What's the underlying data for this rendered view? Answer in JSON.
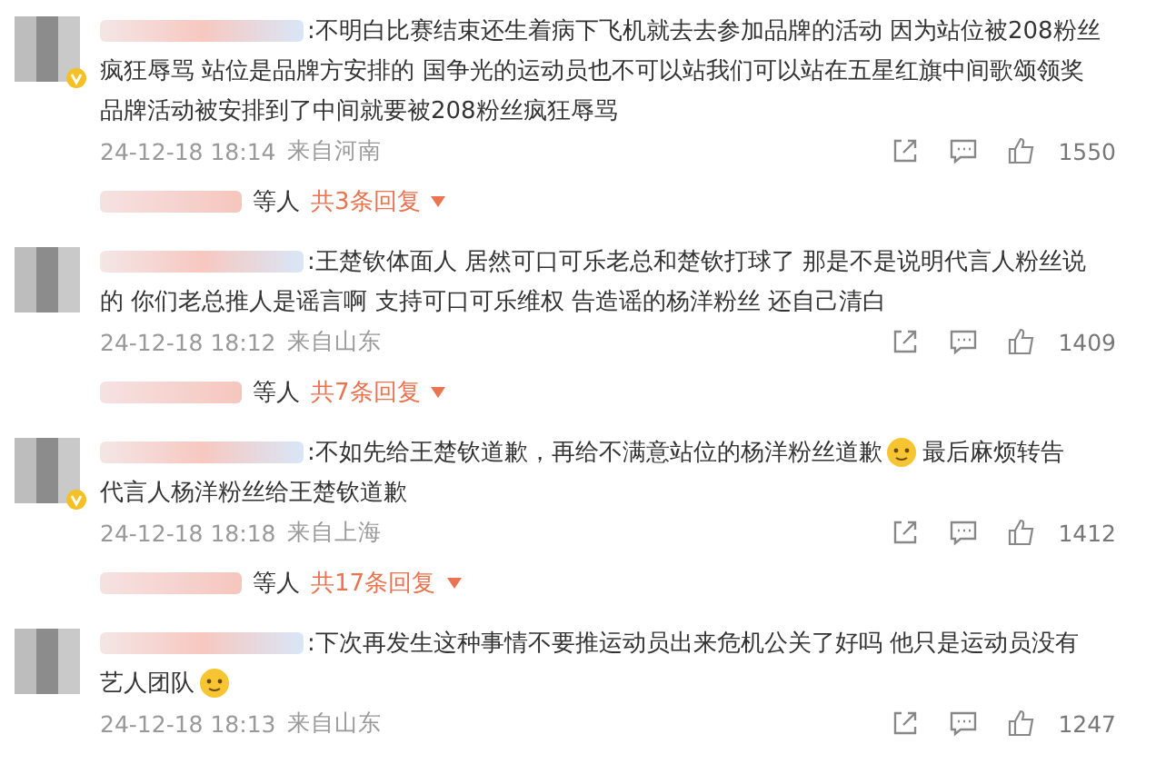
{
  "comments": [
    {
      "verified": true,
      "lines": [
        [
          {
            "kind": "text",
            "text": ":不明白比赛结束还生着病下飞机就去去参加品牌的活动 因为站位被208粉丝"
          }
        ],
        [
          {
            "kind": "text",
            "text": "疯狂辱骂 站位是品牌方安排的 国争光的运动员也不可以站我们可以站在五星红旗中间歌颂领奖"
          }
        ],
        [
          {
            "kind": "text",
            "text": "品牌活动被安排到了中间就要被208粉丝疯狂辱骂"
          }
        ]
      ],
      "time": "24-12-18 18:14",
      "location": "来自河南",
      "likes": "1550",
      "replies": {
        "suffix": "等人",
        "count": "共3条回复"
      }
    },
    {
      "verified": false,
      "lines": [
        [
          {
            "kind": "text",
            "text": ":王楚钦体面人 居然可口可乐老总和楚钦打球了 那是不是说明代言人粉丝说"
          }
        ],
        [
          {
            "kind": "text",
            "text": "的 你们老总推人是谣言啊 支持可口可乐维权 告造谣的杨洋粉丝 还自己清白"
          }
        ]
      ],
      "time": "24-12-18 18:12",
      "location": "来自山东",
      "likes": "1409",
      "replies": {
        "suffix": "等人",
        "count": "共7条回复"
      }
    },
    {
      "verified": true,
      "lines": [
        [
          {
            "kind": "text",
            "text": ":不如先给王楚钦道歉，再给不满意站位的杨洋粉丝道歉"
          },
          {
            "kind": "emoji"
          },
          {
            "kind": "text",
            "text": "最后麻烦转告"
          }
        ],
        [
          {
            "kind": "text",
            "text": "代言人杨洋粉丝给王楚钦道歉"
          }
        ]
      ],
      "time": "24-12-18 18:18",
      "location": "来自上海",
      "likes": "1412",
      "replies": {
        "suffix": "等人",
        "count": "共17条回复"
      }
    },
    {
      "verified": false,
      "lines": [
        [
          {
            "kind": "text",
            "text": ":下次再发生这种事情不要推运动员出来危机公关了好吗 他只是运动员没有"
          }
        ],
        [
          {
            "kind": "text",
            "text": "艺人团队"
          },
          {
            "kind": "emoji"
          }
        ]
      ],
      "time": "24-12-18 18:13",
      "location": "来自山东",
      "likes": "1247"
    }
  ]
}
